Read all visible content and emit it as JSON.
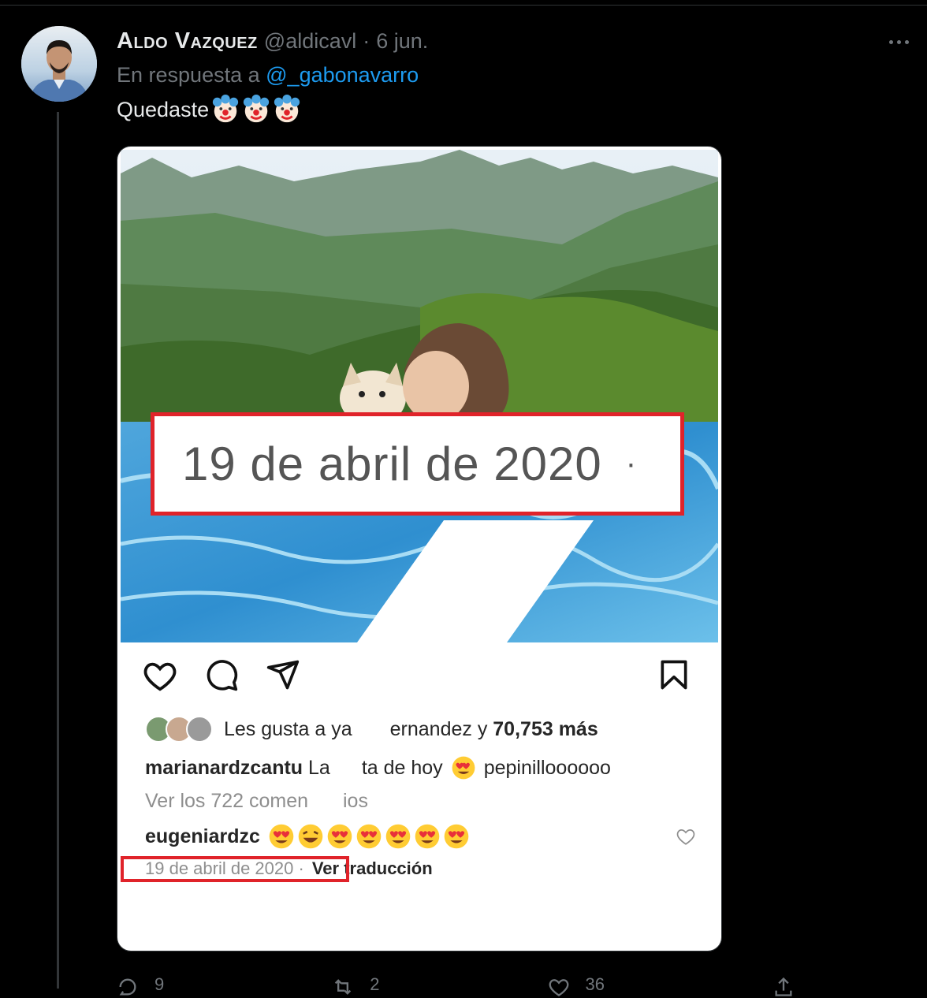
{
  "tweet": {
    "display_name": "Aldo Vazquez",
    "handle": "@aldicavl",
    "separator": "·",
    "timestamp": "6 jun.",
    "reply_prefix": "En respuesta a",
    "reply_mention": "@_gabonavarro",
    "text": "Quedaste",
    "emoji": "clown-face-emoji",
    "more_icon": "more-options-icon"
  },
  "embedded_post": {
    "zoom_date": "19 de abril de 2020",
    "zoom_date_dot": "·",
    "likes_prefix": "Les gusta a ya",
    "likes_suffix": "ernandez y",
    "likes_count": "70,753 más",
    "caption_user": "marianardzcantu",
    "caption_text_a": "La",
    "caption_text_b": "ta de hoy",
    "caption_text_c": "pepinilloooooo",
    "view_comments_a": "Ver los 722 comen",
    "view_comments_b": "ios",
    "comment_user": "eugeniardzc",
    "post_date": "19 de abril de 2020",
    "post_date_dot": "·",
    "translate_label": "Ver traducción",
    "icons": [
      "heart-icon",
      "comment-icon",
      "share-icon",
      "bookmark-icon"
    ]
  },
  "actions": {
    "reply_count": "9",
    "retweet_count": "2",
    "like_count": "36"
  },
  "colors": {
    "background": "#000000",
    "mention_blue": "#1d9bf0",
    "muted": "#71767b",
    "highlight_red": "#e0232a"
  }
}
